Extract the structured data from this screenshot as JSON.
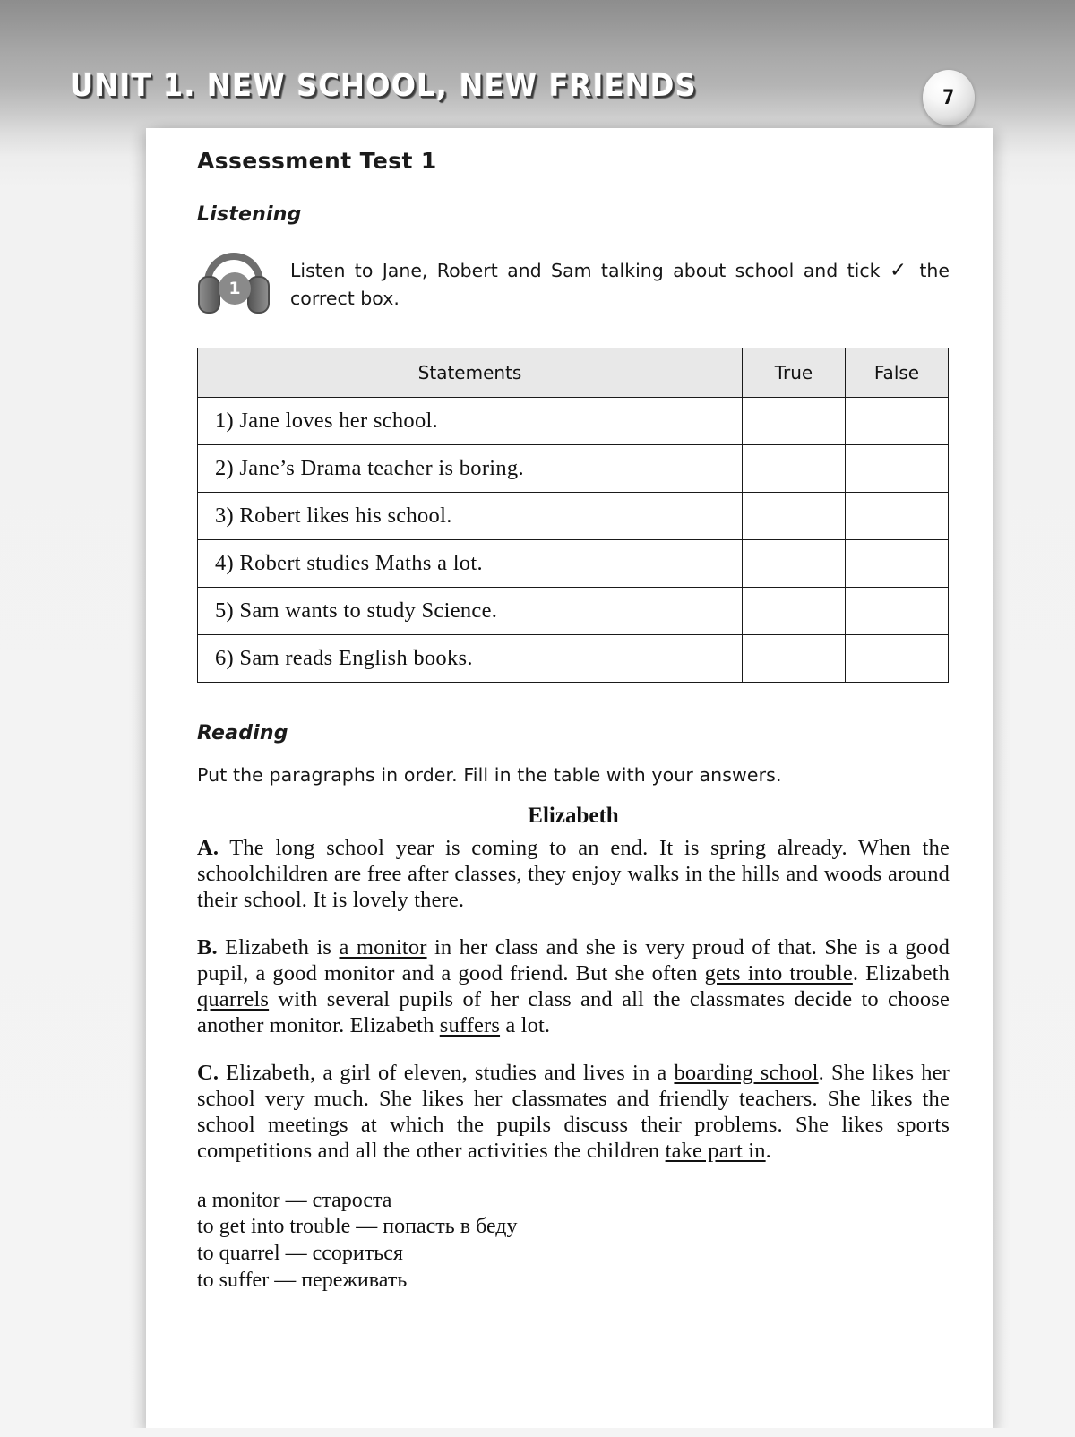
{
  "header": {
    "unit_title": "UNIT 1. NEW SCHOOL, NEW FRIENDS",
    "page_number": "7"
  },
  "page": {
    "test_title": "Assessment Test 1",
    "listening": {
      "section_label": "Listening",
      "task_number": "1",
      "icon": "headphones-icon",
      "instruction_part1": "Listen to Jane, Robert and Sam talking about school and tick ",
      "tick_symbol": "✓",
      "instruction_part2": " the correct box.",
      "table": {
        "headers": [
          "Statements",
          "True",
          "False"
        ],
        "rows": [
          "1) Jane loves her school.",
          "2) Jane’s Drama teacher is boring.",
          "3) Robert likes his school.",
          "4) Robert studies Maths a lot.",
          "5) Sam wants to study Science.",
          "6) Sam reads English books."
        ]
      }
    },
    "reading": {
      "section_label": "Reading",
      "instruction": "Put the paragraphs in order. Fill in the table with your answers.",
      "story_title": "Elizabeth",
      "paragraphs": [
        {
          "letter": "A.",
          "html": " The long school year is coming to an end. It is spring already. When the schoolchildren are free after classes, they enjoy walks in the hills and woods around their school. It is lovely there."
        },
        {
          "letter": "B.",
          "html": " Elizabeth is <u>a monitor</u> in her class and she is very proud of that. She is a good pupil, a good monitor and a good friend. But she often <u>gets into trouble</u>. Elizabeth <u>quarrels</u> with several pupils of her class and all the classmates decide to choose another monitor. Elizabeth <u>suffers</u> a lot."
        },
        {
          "letter": "C.",
          "html": " Elizabeth, a girl of eleven, studies and lives in a <u>boarding school</u>. She likes her school very much. She likes her classmates and friendly teachers. She likes the school meetings at which the pupils discuss their problems. She likes sports competitions and all the other activities the children <u>take part in</u>."
        }
      ],
      "vocabulary": [
        "a monitor — староста",
        "to get into trouble — попасть в беду",
        "to quarrel — ссориться",
        "to suffer — переживать"
      ]
    }
  },
  "colors": {
    "header_text": "#ffffff",
    "table_header_bg": "#e8e8e8",
    "border": "#1a1a1a",
    "body_text": "#111111"
  }
}
